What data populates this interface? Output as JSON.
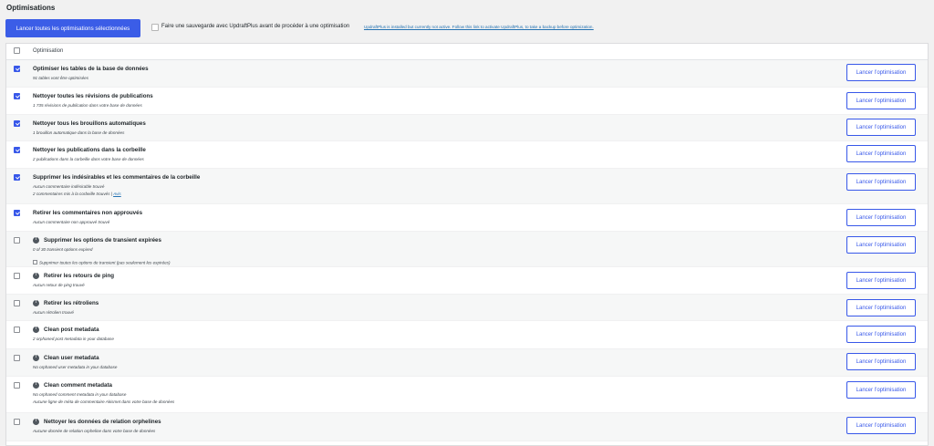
{
  "page": {
    "title": "Optimisations"
  },
  "top_bar": {
    "run_all_label": "Lancer toutes les optimisations sélectionnées",
    "backup_checked": false,
    "backup_label": "Faire une sauvegarde avec UpdraftPlus avant de procéder à une optimisation",
    "backup_link": "UpdraftPlus is installed but currently not active. Follow this link to activate UpdraftPlus, to take a backup before optimization."
  },
  "table": {
    "header_label": "Optimisation",
    "header_checked": false,
    "button_label": "Lancer l’optimisation",
    "rows": [
      {
        "title": "Optimiser les tables de la base de données",
        "checked": true,
        "warning": false,
        "details": [
          "91 tables vont être optimisées"
        ]
      },
      {
        "title": "Nettoyer toutes les révisions de publications",
        "checked": true,
        "warning": false,
        "details": [
          "1 735 révisions de publication dans votre base de données"
        ]
      },
      {
        "title": "Nettoyer tous les brouillons automatiques",
        "checked": true,
        "warning": false,
        "details": [
          "1 brouillon automatique dans la base de données"
        ]
      },
      {
        "title": "Nettoyer les publications dans la corbeille",
        "checked": true,
        "warning": false,
        "details": [
          "2 publications dans la corbeille dans votre base de données"
        ]
      },
      {
        "title": "Supprimer les indésirables et les commentaires de la corbeille",
        "checked": true,
        "warning": false,
        "details": [
          "Aucun commentaire indésirable trouvé",
          "2 commentaires mis à la corbeille trouvés | "
        ],
        "detail_link": "Avis"
      },
      {
        "title": "Retirer les commentaires non approuvés",
        "checked": true,
        "warning": false,
        "details": [
          "Aucun commentaire non approuvé trouvé"
        ]
      },
      {
        "title": "Supprimer les options de transient expirées",
        "checked": false,
        "warning": true,
        "details": [
          "0 of 30 transient options expired"
        ],
        "sub_option": "Supprimer toutes les options de transient (pas seulement les expirées)"
      },
      {
        "title": "Retirer les retours de ping",
        "checked": false,
        "warning": true,
        "details": [
          "Aucun retour de ping trouvé"
        ]
      },
      {
        "title": "Retirer les rétroliens",
        "checked": false,
        "warning": true,
        "details": [
          "Aucun rétrolien trouvé"
        ]
      },
      {
        "title": "Clean post metadata",
        "checked": false,
        "warning": true,
        "details": [
          "2 orphaned post metadata in your database"
        ]
      },
      {
        "title": "Clean user metadata",
        "checked": false,
        "warning": true,
        "details": [
          "No orphaned user metadata in your database"
        ]
      },
      {
        "title": "Clean comment metadata",
        "checked": false,
        "warning": true,
        "details": [
          "No orphaned comment metadata in your database",
          "Aucune ligne de méta de commentaire Akismet dans votre base de données"
        ]
      },
      {
        "title": "Nettoyer les données de relation orphelines",
        "checked": false,
        "warning": true,
        "details": [
          "Aucune donnée de relation orpheline dans votre base de données"
        ]
      }
    ]
  },
  "colors": {
    "primary": "#3858e9",
    "run_all_bg": "#3b5de7",
    "link": "#2271b1",
    "page_bg": "#f1f1f1"
  },
  "icons": {
    "warning": "exclamation-circle-icon",
    "checkbox": "checkbox-icon"
  }
}
